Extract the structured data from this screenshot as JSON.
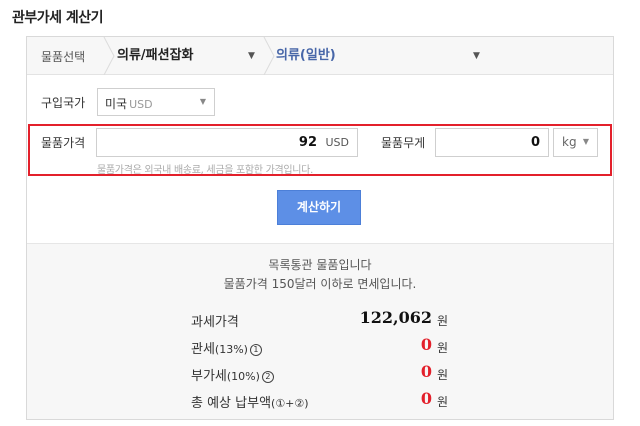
{
  "page": {
    "title": "관부가세 계산기"
  },
  "category": {
    "label": "물품선택",
    "level1": "의류/패션잡화",
    "level2": "의류(일반)"
  },
  "country": {
    "label": "구입국가",
    "value": "미국",
    "currency": "USD"
  },
  "price": {
    "label": "물품가격",
    "value": "92",
    "unit": "USD",
    "note": "물품가격은 외국내 배송료, 세금을 포함한 가격입니다."
  },
  "weight": {
    "label": "물품무게",
    "value": "0",
    "unit": "kg"
  },
  "calc_button": {
    "label": "계산하기"
  },
  "results": {
    "message1": "목록통관 물품입니다",
    "message2": "물품가격 150달러 이하로 면세입니다.",
    "rows": [
      {
        "label": "과세가격",
        "suffix": "",
        "badge": "",
        "value": "122,062",
        "unit": "원"
      },
      {
        "label": "관세",
        "suffix": "(13%)",
        "badge": "1",
        "value": "0",
        "unit": "원"
      },
      {
        "label": "부가세",
        "suffix": "(10%)",
        "badge": "2",
        "value": "0",
        "unit": "원"
      },
      {
        "label": "총 예상 납부액",
        "suffix": "(①+②)",
        "badge": "",
        "value": "0",
        "unit": "원"
      }
    ]
  },
  "colors": {
    "accent": "#5d8fe6",
    "highlight": "#e3202b",
    "category_active": "#4766a8"
  }
}
